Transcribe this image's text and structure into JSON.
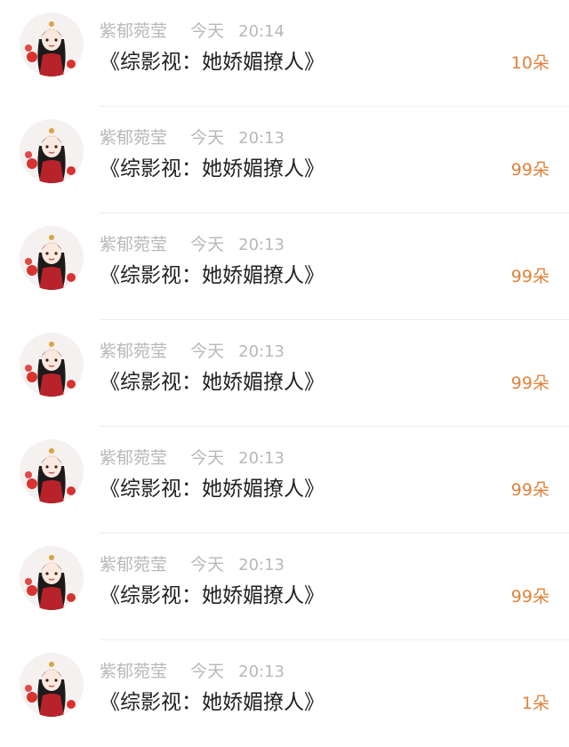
{
  "items": [
    {
      "user": "紫郁菀莹",
      "day": "今天",
      "time": "20:14",
      "title": "《综影视：她娇媚撩人》",
      "count": "10",
      "unit": "朵",
      "avatar_icon": "girl-avatar-icon"
    },
    {
      "user": "紫郁菀莹",
      "day": "今天",
      "time": "20:13",
      "title": "《综影视：她娇媚撩人》",
      "count": "99",
      "unit": "朵",
      "avatar_icon": "girl-avatar-icon"
    },
    {
      "user": "紫郁菀莹",
      "day": "今天",
      "time": "20:13",
      "title": "《综影视：她娇媚撩人》",
      "count": "99",
      "unit": "朵",
      "avatar_icon": "girl-avatar-icon"
    },
    {
      "user": "紫郁菀莹",
      "day": "今天",
      "time": "20:13",
      "title": "《综影视：她娇媚撩人》",
      "count": "99",
      "unit": "朵",
      "avatar_icon": "girl-avatar-icon"
    },
    {
      "user": "紫郁菀莹",
      "day": "今天",
      "time": "20:13",
      "title": "《综影视：她娇媚撩人》",
      "count": "99",
      "unit": "朵",
      "avatar_icon": "girl-avatar-icon"
    },
    {
      "user": "紫郁菀莹",
      "day": "今天",
      "time": "20:13",
      "title": "《综影视：她娇媚撩人》",
      "count": "99",
      "unit": "朵",
      "avatar_icon": "girl-avatar-icon"
    },
    {
      "user": "紫郁菀莹",
      "day": "今天",
      "time": "20:13",
      "title": "《综影视：她娇媚撩人》",
      "count": "1",
      "unit": "朵",
      "avatar_icon": "girl-avatar-icon"
    }
  ],
  "colors": {
    "count": "#e0823c",
    "meta": "#b8b8b8",
    "title": "#222222"
  }
}
